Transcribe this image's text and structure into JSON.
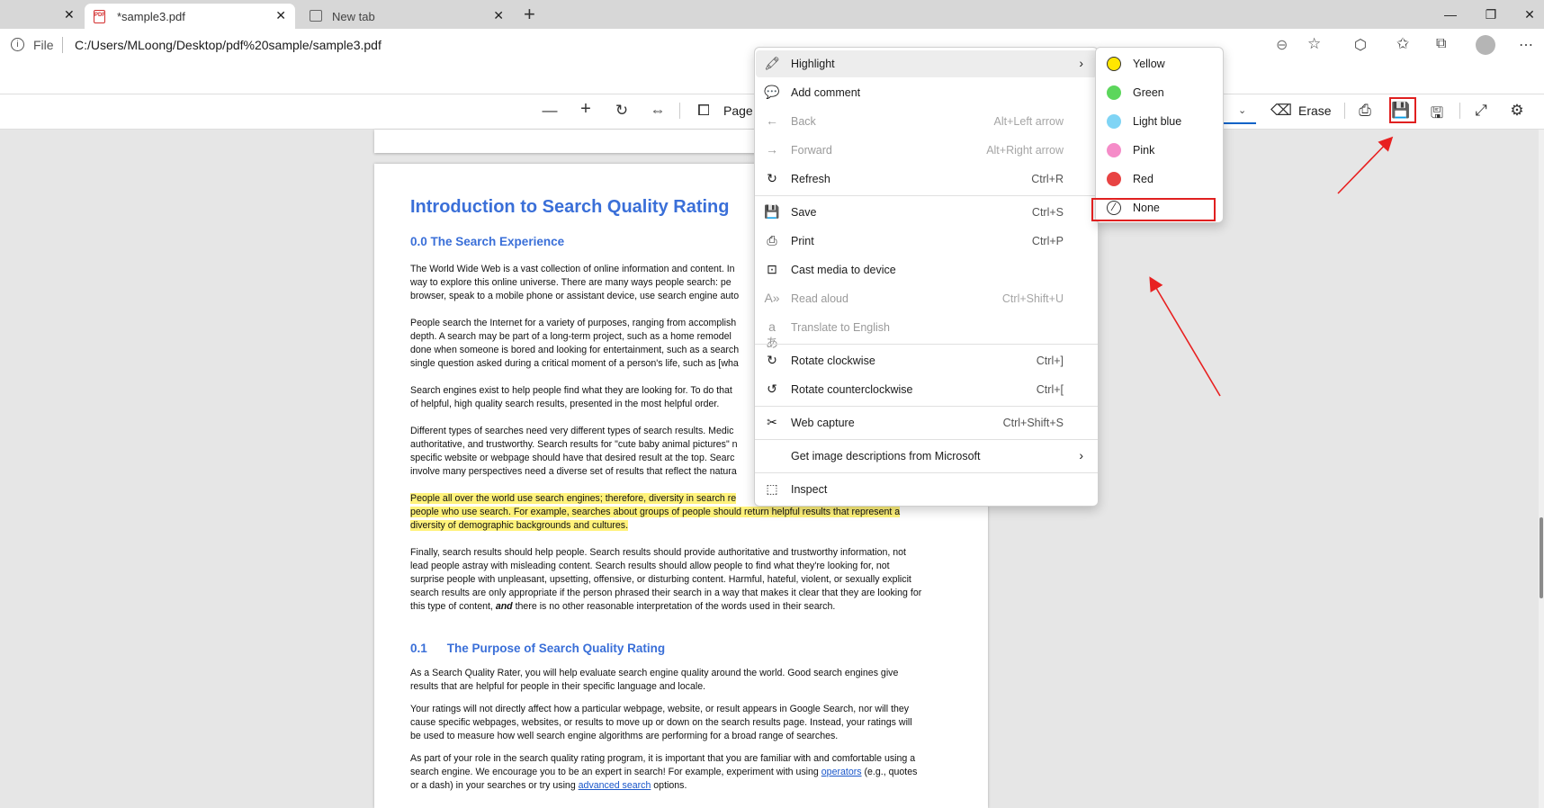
{
  "browser": {
    "prev_tab_close": "✕",
    "active_tab_title": "*sample3.pdf",
    "new_tab_title": "New tab",
    "address_scheme": "File",
    "address_url": "C:/Users/MLoong/Desktop/pdf%20sample/sample3.pdf"
  },
  "pdf_toolbar": {
    "page_label": "Page",
    "erase_label": "Erase"
  },
  "context_menu": {
    "items": [
      {
        "label": "Highlight",
        "shortcut": "",
        "icon": "highlighter-icon",
        "disabled": false,
        "submenu": true
      },
      {
        "label": "Add comment",
        "shortcut": "",
        "icon": "comment-icon",
        "disabled": false
      },
      {
        "label": "Back",
        "shortcut": "Alt+Left arrow",
        "icon": "back-arrow-icon",
        "disabled": true
      },
      {
        "label": "Forward",
        "shortcut": "Alt+Right arrow",
        "icon": "forward-arrow-icon",
        "disabled": true
      },
      {
        "label": "Refresh",
        "shortcut": "Ctrl+R",
        "icon": "refresh-icon",
        "disabled": false
      },
      {
        "label": "Save",
        "shortcut": "Ctrl+S",
        "icon": "save-icon",
        "disabled": false
      },
      {
        "label": "Print",
        "shortcut": "Ctrl+P",
        "icon": "print-icon",
        "disabled": false
      },
      {
        "label": "Cast media to device",
        "shortcut": "",
        "icon": "cast-icon",
        "disabled": false
      },
      {
        "label": "Read aloud",
        "shortcut": "Ctrl+Shift+U",
        "icon": "read-aloud-icon",
        "disabled": true
      },
      {
        "label": "Translate to English",
        "shortcut": "",
        "icon": "translate-icon",
        "disabled": true
      },
      {
        "label": "Rotate clockwise",
        "shortcut": "Ctrl+]",
        "icon": "rotate-clockwise-icon",
        "disabled": false
      },
      {
        "label": "Rotate counterclockwise",
        "shortcut": "Ctrl+[",
        "icon": "rotate-counterclockwise-icon",
        "disabled": false
      },
      {
        "label": "Web capture",
        "shortcut": "Ctrl+Shift+S",
        "icon": "web-capture-icon",
        "disabled": false
      },
      {
        "label": "Get image descriptions from Microsoft",
        "shortcut": "",
        "icon": "",
        "disabled": false,
        "submenu": true
      },
      {
        "label": "Inspect",
        "shortcut": "",
        "icon": "inspect-icon",
        "disabled": false
      }
    ]
  },
  "highlight_submenu": {
    "items": [
      {
        "label": "Yellow",
        "color": "#ffe600"
      },
      {
        "label": "Green",
        "color": "#5cd65c"
      },
      {
        "label": "Light blue",
        "color": "#7fd4f5"
      },
      {
        "label": "Pink",
        "color": "#f58cc8"
      },
      {
        "label": "Red",
        "color": "#e84343"
      },
      {
        "label": "None",
        "color": ""
      }
    ]
  },
  "document": {
    "title": "Introduction to Search Quality Rating",
    "section_00": "0.0 The Search Experience",
    "p1": "The World Wide Web is a vast collection of online information and content.  In",
    "p1b": "way to explore this online universe.  There are many ways people search: pe",
    "p1c": "browser, speak to a mobile phone or assistant device, use search engine auto",
    "p2": "People search the Internet  for a variety of purposes, ranging from accomplish",
    "p2b": "depth.  A search may be part of a long-term project, such as a home remodel",
    "p2c": "done when someone is bored and looking for entertainment, such as a search",
    "p2d": "single question asked during a critical moment of a person's life, such as [wha",
    "p3": "Search engines exist to help people find what they are looking for.  To do that",
    "p3b": "of helpful, high quality search results, presented in the most helpful order.",
    "p4": "Different types of searches need very different types of search results.  Medic",
    "p4b": "authoritative, and trustworthy.  Search results for \"cute baby animal pictures\" n",
    "p4c": "specific website or webpage should have that desired result at the top.  Searc",
    "p4d": "involve many perspectives need a diverse set of results that reflect the natura",
    "p5": "People all over the world use search engines; therefore, diversity in search re",
    "p5b": "people who use search.  For example, searches about groups of people should return helpful results that represent a",
    "p5c": "diversity of demographic backgrounds and cultures.",
    "p6": "Finally, search results should help people.  Search results should provide authoritative and trustworthy information, not",
    "p6b": "lead people astray with misleading content.  Search results should allow people to find what they're looking for, not",
    "p6c": "surprise people with unpleasant, upsetting, offensive, or disturbing content.  Harmful, hateful, violent, or sexually explicit",
    "p6d": "search results are only appropriate if the person phrased their search in a way that makes it clear that they are looking for",
    "p6e_pre": "this type of content, ",
    "p6e_em": "and",
    "p6e_post": " there is no other reasonable interpretation of the words used in their search.",
    "section_01_num": "0.1",
    "section_01_title": "The Purpose of Search Quality Rating",
    "p7": "As a Search Quality Rater, you will help evaluate search engine quality around the world.  Good search engines give",
    "p7b": "results that are helpful for people in their specific language and locale.",
    "p8": "Your ratings will not directly affect how a particular webpage, website, or result appears in Google Search, nor will they",
    "p8b": "cause specific webpages, websites, or results to move up or down on the search results page.  Instead, your ratings will",
    "p8c": "be used to measure how well search engine algorithms are performing for a broad range of searches.",
    "p9": "As part of your role in the search quality rating program, it is important that you are familiar with and comfortable using a",
    "p9b_pre": "search engine.  We encourage you to be an expert in search!  For example, experiment with using ",
    "p9b_link": "operators",
    "p9b_post": " (e.g., quotes",
    "p9c_pre": "or a dash) in your searches or try using ",
    "p9c_link": "advanced search",
    "p9c_post": " options."
  }
}
